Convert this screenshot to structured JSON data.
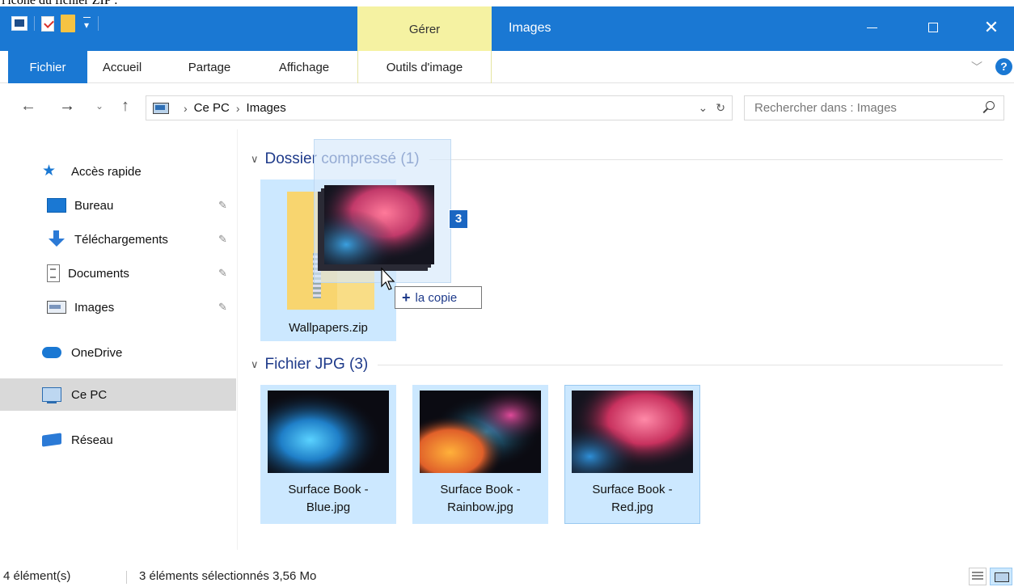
{
  "caption_fragment": "l'icône du fichier ZIP :",
  "window": {
    "title": "Images",
    "contextual_tab_group": "Gérer"
  },
  "ribbon": {
    "tabs": [
      "Fichier",
      "Accueil",
      "Partage",
      "Affichage",
      "Outils d'image"
    ]
  },
  "navigation": {
    "breadcrumb": [
      "Ce PC",
      "Images"
    ],
    "search_placeholder": "Rechercher dans : Images"
  },
  "sidebar": {
    "quick_access": "Accès rapide",
    "items": [
      {
        "label": "Bureau",
        "icon": "desktop-icon",
        "pinned": true
      },
      {
        "label": "Téléchargements",
        "icon": "downloads-icon",
        "pinned": true
      },
      {
        "label": "Documents",
        "icon": "documents-icon",
        "pinned": true
      },
      {
        "label": "Images",
        "icon": "pictures-icon",
        "pinned": true
      }
    ],
    "onedrive": "OneDrive",
    "this_pc": "Ce PC",
    "network": "Réseau"
  },
  "groups": {
    "zip": {
      "title": "Dossier compressé (1)"
    },
    "jpg": {
      "title": "Fichier JPG (3)"
    }
  },
  "files": {
    "zip": {
      "name": "Wallpapers.zip"
    },
    "jpg": [
      {
        "name_line1": "Surface Book -",
        "name_line2": "Blue.jpg"
      },
      {
        "name_line1": "Surface Book -",
        "name_line2": "Rainbow.jpg"
      },
      {
        "name_line1": "Surface Book -",
        "name_line2": "Red.jpg"
      }
    ]
  },
  "drag": {
    "count": "3",
    "action_label": "la copie"
  },
  "status": {
    "item_count": "4 élément(s)",
    "selection": "3 éléments sélectionnés  3,56 Mo"
  },
  "colors": {
    "title_bar": "#1a78d3",
    "manage_tab": "#f5f2a2",
    "selection": "#cce8ff",
    "group_header": "#1e3a8a"
  }
}
